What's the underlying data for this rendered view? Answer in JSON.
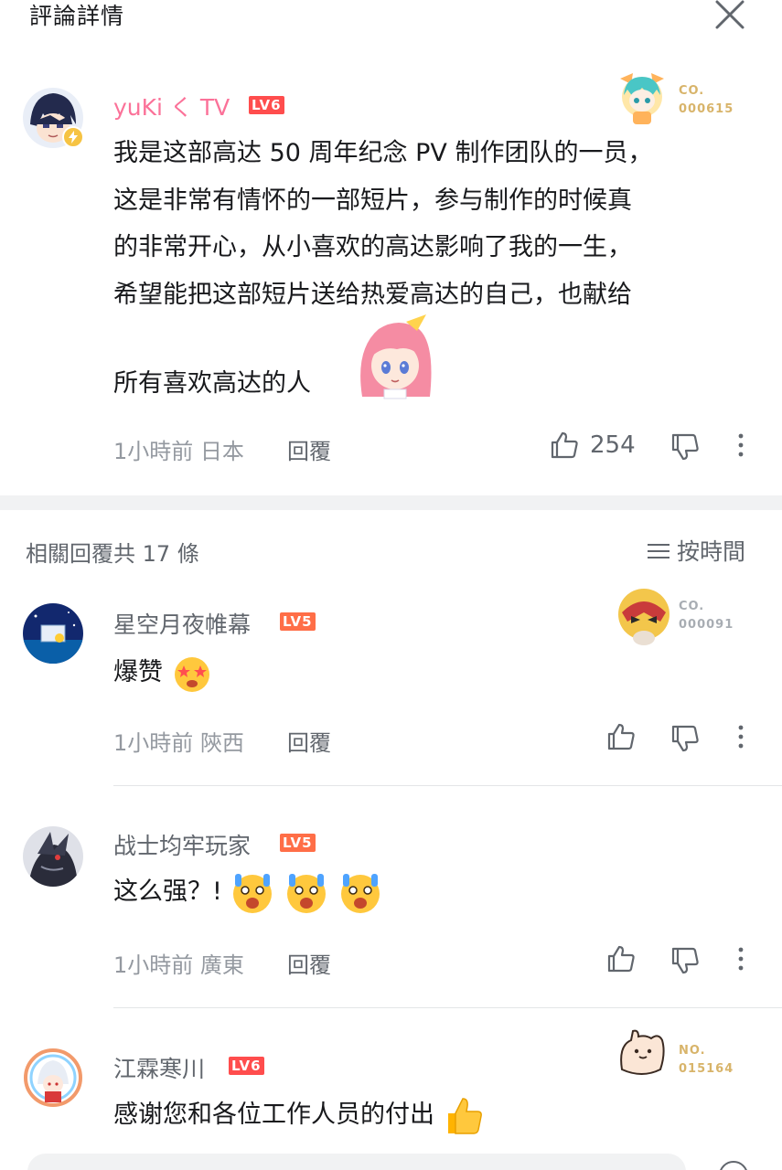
{
  "header": {
    "title": "評論詳情"
  },
  "main_comment": {
    "username": "yuKi く TV",
    "level": "LV6",
    "fan_label_top": "CO.",
    "fan_label_bottom": "000615",
    "text_lines": [
      "我是这部高达 50 周年纪念 PV 制作团队的一员，",
      "这是非常有情怀的一部短片，参与制作的时候真",
      "的非常开心，从小喜欢的高达影响了我的一生，",
      "希望能把这部短片送给热爱高达的自己，也献给",
      "所有喜欢高达的人"
    ],
    "time": "1小時前 日本",
    "reply_label": "回覆",
    "like_count": "254"
  },
  "replies": {
    "title": "相關回覆共 17 條",
    "sort_label": "按時間",
    "items": [
      {
        "username": "星空月夜帷幕",
        "level": "LV5",
        "fan_label_top": "CO.",
        "fan_label_bottom": "000091",
        "text": "爆赞",
        "time": "1小時前 陝西",
        "reply_label": "回覆"
      },
      {
        "username": "战士均牢玩家",
        "level": "LV5",
        "text": "这么强？!",
        "time": "1小時前 廣東",
        "reply_label": "回覆"
      },
      {
        "username": "江霖寒川",
        "level": "LV6",
        "fan_label_top": "NO.",
        "fan_label_bottom": "015164",
        "text": "感谢您和各位工作人员的付出"
      }
    ]
  },
  "colors": {
    "accent_pink": "#fb7299",
    "level_orange": "#ff6e47",
    "text_secondary": "#61666d",
    "text_muted": "#9499a0"
  },
  "icons": [
    "close-icon",
    "like-icon",
    "dislike-icon",
    "more-icon",
    "sort-icon",
    "lightning-badge-icon",
    "thumbs-up-emoji",
    "star-eyes-emoji",
    "shocked-emoji"
  ]
}
